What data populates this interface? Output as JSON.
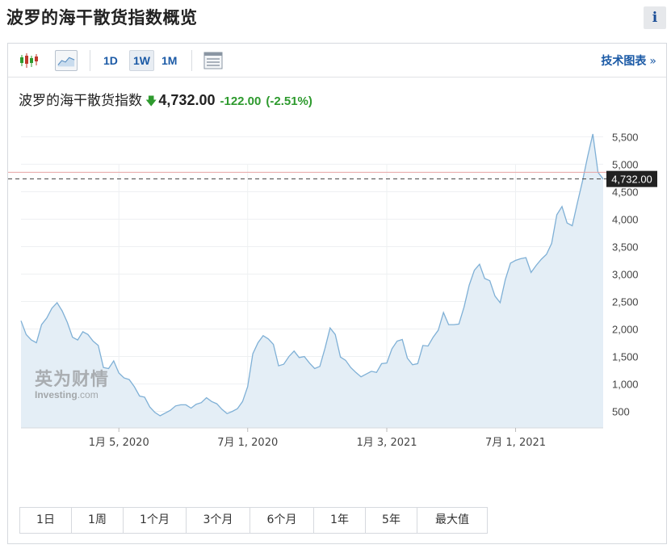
{
  "header": {
    "title": "波罗的海干散货指数概览",
    "info_label": "i"
  },
  "toolbar": {
    "icons": [
      "candlestick-chart-icon",
      "area-chart-icon",
      "table-view-icon"
    ],
    "intervals": [
      {
        "label": "1D",
        "active": false
      },
      {
        "label": "1W",
        "active": true
      },
      {
        "label": "1M",
        "active": false
      }
    ],
    "tech_chart_label": "技术图表",
    "tech_chart_arrow": "»"
  },
  "quote": {
    "name": "波罗的海干散货指数",
    "direction_icon": "down-arrow-icon",
    "price": "4,732.00",
    "change": "-122.00",
    "change_pct": "(-2.51%)",
    "change_color": "#2e9a2e"
  },
  "watermark": {
    "brand_cn": "英为财情",
    "brand_en": "Investing",
    "brand_suffix": ".com"
  },
  "chart_data": {
    "type": "area",
    "title": "",
    "xlabel": "",
    "ylabel": "",
    "ylim": [
      200,
      5800
    ],
    "y_ticks": [
      "500",
      "1,000",
      "1,500",
      "2,000",
      "2,500",
      "3,000",
      "3,500",
      "4,000",
      "4,500",
      "5,000",
      "5,500"
    ],
    "y_tick_values": [
      500,
      1000,
      1500,
      2000,
      2500,
      3000,
      3500,
      4000,
      4500,
      5000,
      5500
    ],
    "x_ticks": [
      "1月 5, 2020",
      "7月 1, 2020",
      "1月 3, 2021",
      "7月 1, 2021"
    ],
    "x_tick_weeks": [
      19,
      44,
      71,
      96
    ],
    "last_price_label": "4,732.00",
    "last_price": 4732,
    "prev_close": 4854,
    "x_weeks_start": 0,
    "line_color": "#7fb0d6",
    "fill_color": "#e4eef6",
    "values": [
      2150,
      1900,
      1800,
      1750,
      2080,
      2200,
      2380,
      2480,
      2330,
      2120,
      1850,
      1800,
      1950,
      1900,
      1780,
      1700,
      1300,
      1280,
      1420,
      1200,
      1110,
      1080,
      950,
      780,
      760,
      580,
      480,
      420,
      470,
      520,
      600,
      620,
      620,
      560,
      630,
      660,
      750,
      680,
      640,
      540,
      460,
      500,
      550,
      680,
      950,
      1550,
      1750,
      1880,
      1820,
      1720,
      1330,
      1360,
      1500,
      1600,
      1480,
      1500,
      1380,
      1280,
      1320,
      1650,
      2020,
      1900,
      1490,
      1430,
      1300,
      1210,
      1130,
      1180,
      1230,
      1210,
      1370,
      1380,
      1640,
      1780,
      1810,
      1470,
      1350,
      1370,
      1700,
      1690,
      1850,
      1980,
      2300,
      2080,
      2080,
      2090,
      2400,
      2800,
      3070,
      3180,
      2920,
      2880,
      2600,
      2480,
      2900,
      3200,
      3250,
      3280,
      3300,
      3030,
      3160,
      3270,
      3360,
      3560,
      4080,
      4230,
      3930,
      3880,
      4300,
      4700,
      5150,
      5550,
      4854,
      4732
    ]
  },
  "ranges": [
    "1日",
    "1周",
    "1个月",
    "3个月",
    "6个月",
    "1年",
    "5年",
    "最大值"
  ]
}
